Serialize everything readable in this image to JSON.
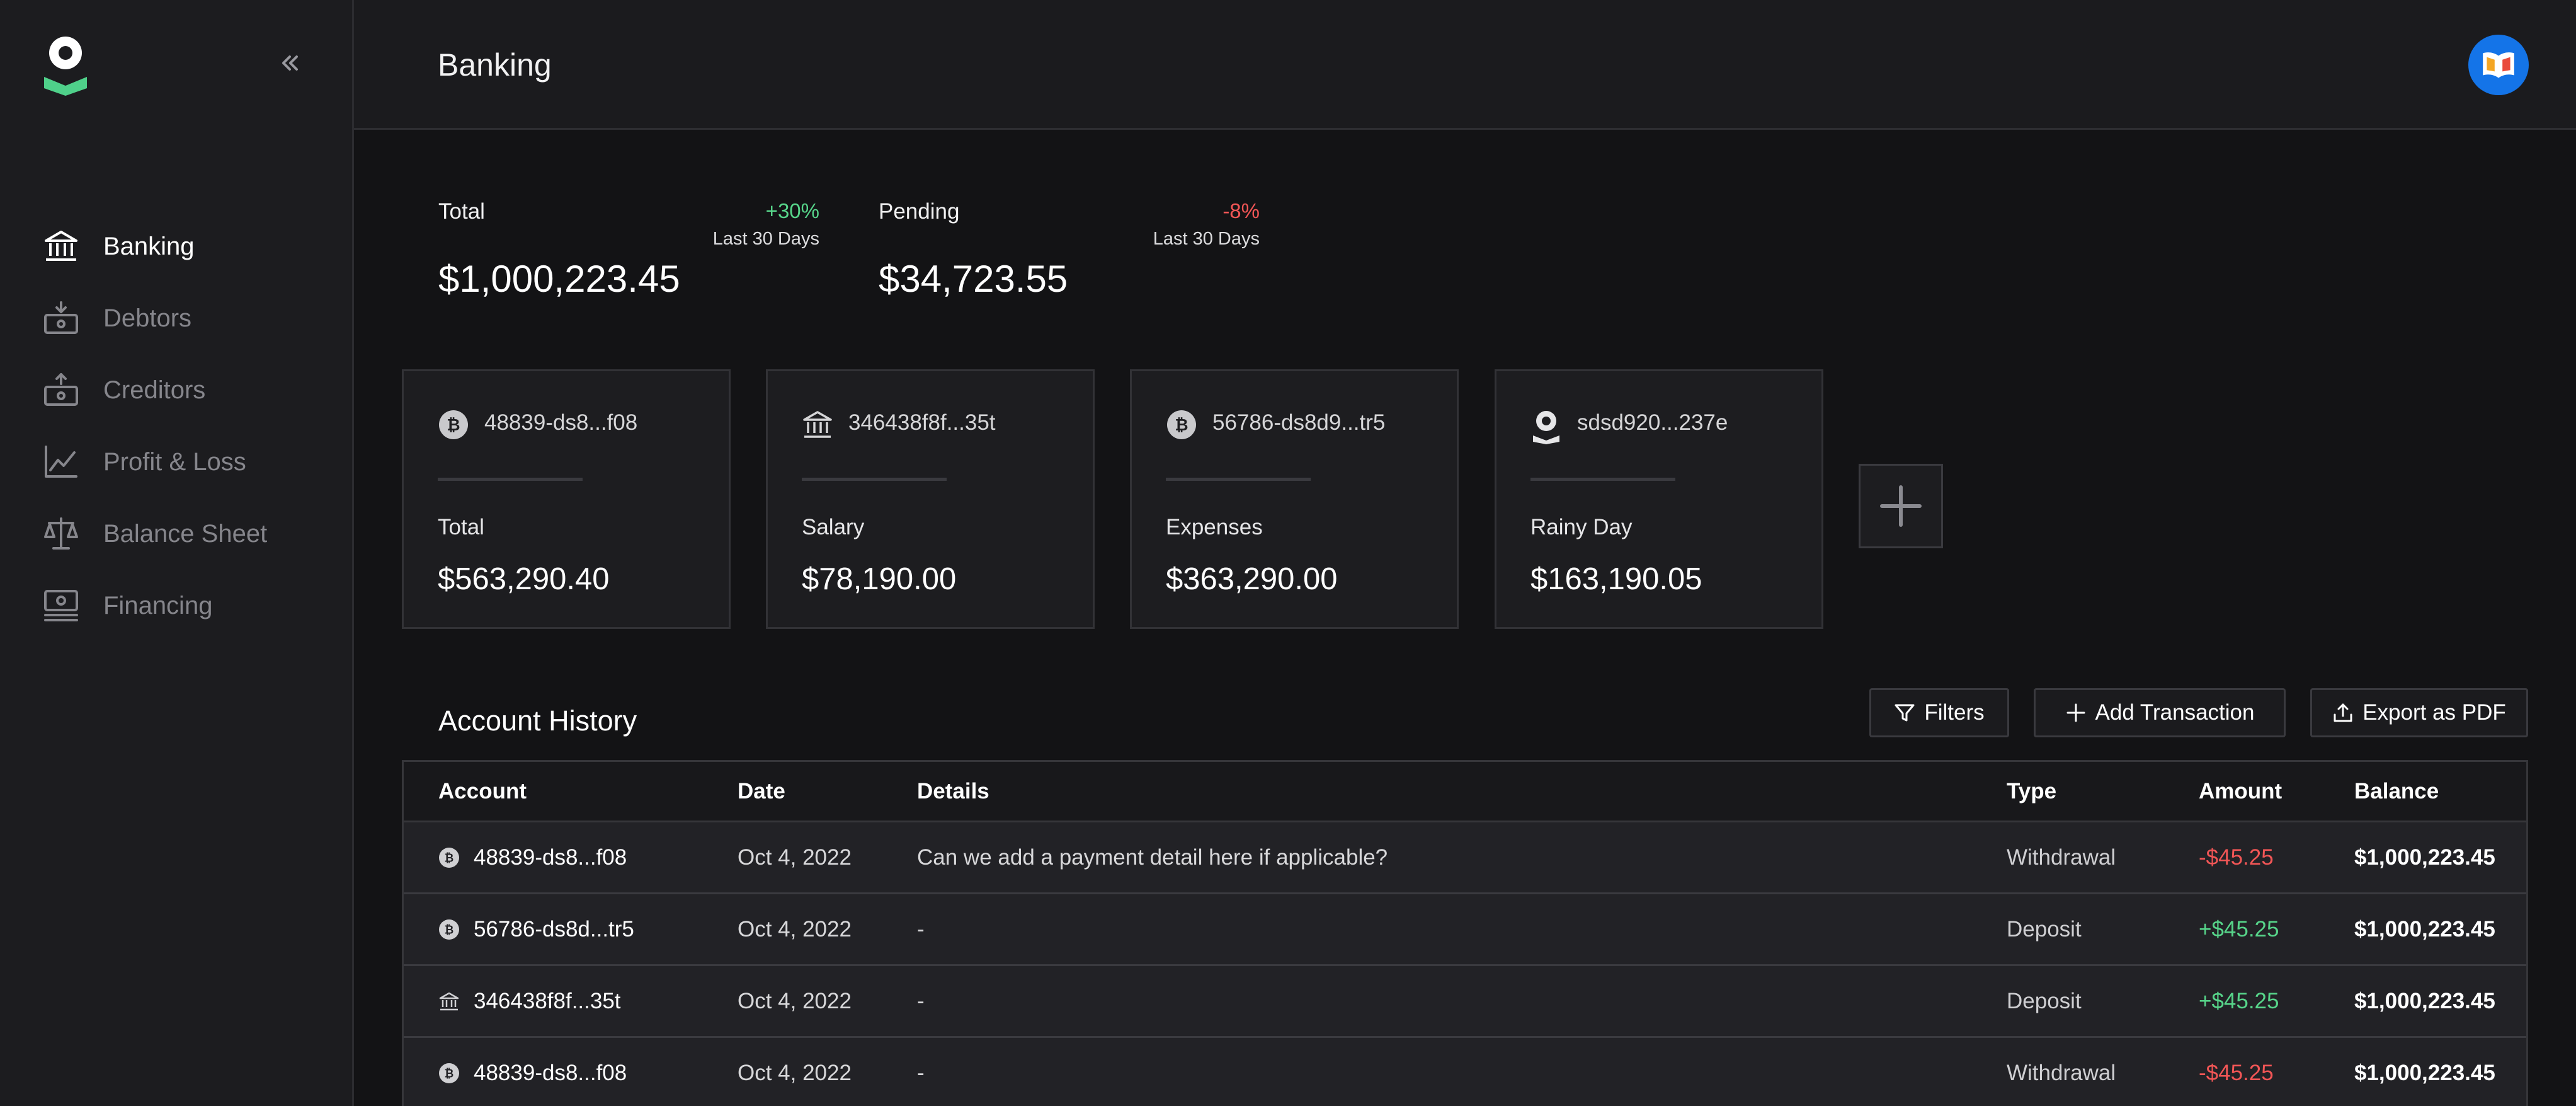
{
  "app": {
    "page_title": "Banking"
  },
  "sidebar": {
    "collapse_icon": "chevrons-left-icon",
    "items": [
      {
        "label": "Banking",
        "icon": "bank-icon",
        "active": true
      },
      {
        "label": "Debtors",
        "icon": "debtors-icon",
        "active": false
      },
      {
        "label": "Creditors",
        "icon": "creditors-icon",
        "active": false
      },
      {
        "label": "Profit & Loss",
        "icon": "chart-line-icon",
        "active": false
      },
      {
        "label": "Balance Sheet",
        "icon": "scale-icon",
        "active": false
      },
      {
        "label": "Financing",
        "icon": "financing-icon",
        "active": false
      }
    ]
  },
  "stats": [
    {
      "label": "Total",
      "value": "$1,000,223.45",
      "change": "+30%",
      "period": "Last 30 Days",
      "trend": "up"
    },
    {
      "label": "Pending",
      "value": "$34,723.55",
      "change": "-8%",
      "period": "Last 30 Days",
      "trend": "down"
    }
  ],
  "accounts": [
    {
      "name": "48839-ds8...f08",
      "label": "Total",
      "amount": "$563,290.40",
      "icon": "bitcoin-icon"
    },
    {
      "name": "346438f8f...35t",
      "label": "Salary",
      "amount": "$78,190.00",
      "icon": "bank-icon"
    },
    {
      "name": "56786-ds8d9...tr5",
      "label": "Expenses",
      "amount": "$363,290.00",
      "icon": "bitcoin-icon"
    },
    {
      "name": "sdsd920...237e",
      "label": "Rainy Day",
      "amount": "$163,190.05",
      "icon": "logo-icon"
    }
  ],
  "history": {
    "title": "Account History",
    "buttons": {
      "filters": "Filters",
      "add": "Add Transaction",
      "export": "Export as PDF"
    },
    "columns": {
      "account": "Account",
      "date": "Date",
      "details": "Details",
      "type": "Type",
      "amount": "Amount",
      "balance": "Balance"
    },
    "rows": [
      {
        "account": "48839-ds8...f08",
        "icon": "bitcoin-icon",
        "date": "Oct 4, 2022",
        "details": "Can we add a payment detail here if applicable?",
        "type": "Withdrawal",
        "amount": "-$45.25",
        "balance": "$1,000,223.45"
      },
      {
        "account": "56786-ds8d...tr5",
        "icon": "bitcoin-icon",
        "date": "Oct 4, 2022",
        "details": "-",
        "type": "Deposit",
        "amount": "+$45.25",
        "balance": "$1,000,223.45"
      },
      {
        "account": "346438f8f...35t",
        "icon": "bank-icon",
        "date": "Oct 4, 2022",
        "details": "-",
        "type": "Deposit",
        "amount": "+$45.25",
        "balance": "$1,000,223.45"
      },
      {
        "account": "48839-ds8...f08",
        "icon": "bitcoin-icon",
        "date": "Oct 4, 2022",
        "details": "-",
        "type": "Withdrawal",
        "amount": "-$45.25",
        "balance": "$1,000,223.45"
      }
    ]
  },
  "colors": {
    "positive": "#57d58a",
    "negative": "#f25656",
    "avatar_bg": "#1474e8",
    "logo_accent": "#4fd08a"
  }
}
